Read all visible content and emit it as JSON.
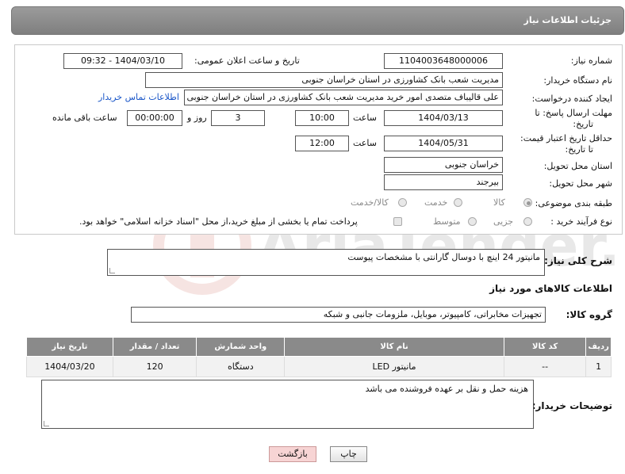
{
  "header": {
    "title": "جزئیات اطلاعات نیاز"
  },
  "form": {
    "need_number_label": "شماره نیاز:",
    "need_number": "1104003648000006",
    "announce_label": "تاریخ و ساعت اعلان عمومی:",
    "announce_value": "1404/03/10 - 09:32",
    "buyer_org_label": "نام دستگاه خریدار:",
    "buyer_org": "مدیریت شعب بانک کشاورزی در استان خراسان جنوبی",
    "requester_label": "ایجاد کننده درخواست:",
    "requester": "علی قالیباف متصدی امور خرید مدیریت شعب بانک کشاورزی در استان خراسان جنوبی",
    "contact_link": "اطلاعات تماس خریدار",
    "deadline_label_1": "مهلت ارسال پاسخ: تا",
    "deadline_label_2": "تاریخ:",
    "deadline_date": "1404/03/13",
    "time_label": "ساعت",
    "deadline_time": "10:00",
    "days_value": "3",
    "days_label": "روز و",
    "remain_time": "00:00:00",
    "remain_label": "ساعت باقی مانده",
    "min_validity_label_1": "حداقل تاریخ اعتبار قیمت:",
    "min_validity_label_2": "تا تاریخ:",
    "validity_date": "1404/05/31",
    "validity_time": "12:00",
    "province_label": "استان محل تحویل:",
    "province": "خراسان جنوبی",
    "city_label": "شهر محل تحویل:",
    "city": "بیرجند",
    "category_label": "طبقه بندی موضوعی:",
    "category_options": [
      "کالا",
      "خدمت",
      "کالا/خدمت"
    ],
    "purchase_type_label": "نوع فرآیند خرید :",
    "purchase_options": [
      "جزیی",
      "متوسط"
    ],
    "payment_note": "پرداخت تمام یا بخشی از مبلغ خرید،از محل \"اسناد خزانه اسلامی\" خواهد بود."
  },
  "description": {
    "label": "شرح کلی نیاز:",
    "value": "مانیتور 24 اینچ با دوسال گارانتی با مشخصات پیوست"
  },
  "goods_section": {
    "title": "اطلاعات کالاهای مورد نیاز",
    "group_label": "گروه کالا:",
    "group_value": "تجهیزات مخابراتی، کامپیوتر، موبایل، ملزومات جانبی و شبکه"
  },
  "table": {
    "headers": [
      "ردیف",
      "کد کالا",
      "نام کالا",
      "واحد شمارش",
      "تعداد / مقدار",
      "تاریخ نیاز"
    ],
    "rows": [
      [
        "1",
        "--",
        "مانیتور LED",
        "دستگاه",
        "120",
        "1404/03/20"
      ]
    ]
  },
  "buyer_notes": {
    "label": "توضیحات خریدار:",
    "value": "هزینه حمل و نقل بر عهده فروشنده می باشد"
  },
  "buttons": {
    "print": "چاپ",
    "back": "بازگشت"
  },
  "watermark": {
    "text": "AriaTender.neT"
  },
  "colors": {
    "header_bg": "#8a8a8a",
    "link": "#1a56c8",
    "back_button": "#f7d4d4"
  }
}
